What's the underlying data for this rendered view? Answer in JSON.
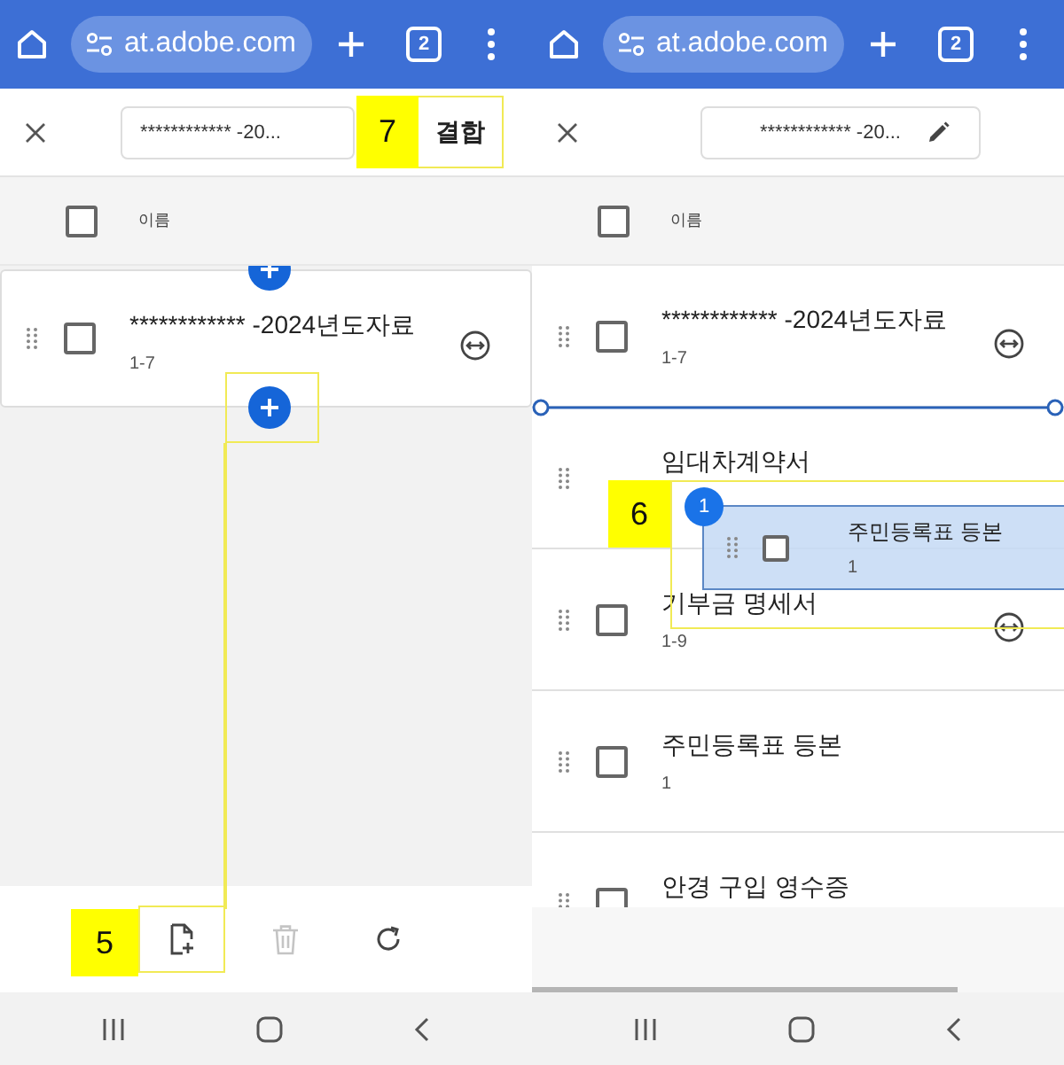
{
  "panels": [
    {
      "browser": {
        "url": "at.adobe.com",
        "tab_count": "2"
      },
      "toolbar": {
        "filename": "************ -20...",
        "trailing": {
          "kind": "button",
          "label": "결합"
        }
      },
      "header": {
        "label": "이름",
        "checked": false
      },
      "insert_buttons": true,
      "rows": [
        {
          "kind": "card",
          "title": "************ -2024년도자료",
          "pages": "1-7",
          "checked": false,
          "expandable": true,
          "drop_indicator": false
        }
      ],
      "bottom_toolbar": [
        {
          "kind": "add-file",
          "disabled": false
        },
        {
          "kind": "delete",
          "disabled": true
        },
        {
          "kind": "refresh",
          "disabled": false
        }
      ],
      "callouts": [
        {
          "kind": "toolbar",
          "label": "7"
        },
        {
          "kind": "bottom",
          "label": "5"
        }
      ]
    },
    {
      "browser": {
        "url": "at.adobe.com",
        "tab_count": "2"
      },
      "toolbar": {
        "filename": "************ -20...",
        "trailing": {
          "kind": "pencil"
        }
      },
      "header": {
        "label": "이름",
        "checked": false
      },
      "rows": [
        {
          "kind": "row",
          "title": "************ -2024년도자료",
          "pages": "1-7",
          "checked": false,
          "expandable": true,
          "drop_indicator": true
        },
        {
          "kind": "row",
          "title": "임대차계약서",
          "expandable": false,
          "drop_indicator": false
        },
        {
          "kind": "row",
          "title": "기부금 명세서",
          "pages": "1-9",
          "checked": false,
          "expandable": true,
          "drop_indicator": false
        },
        {
          "kind": "row",
          "title": "주민등록표 등본",
          "pages": "1",
          "checked": false,
          "expandable": false,
          "drop_indicator": false
        },
        {
          "kind": "row",
          "title": "안경 구입 영수증",
          "checked": false,
          "expandable": false,
          "drop_indicator": false
        }
      ],
      "drag_card": {
        "title": "주민등록표 등본",
        "pages": "1",
        "count": "1",
        "checked": false
      },
      "callouts": [
        {
          "kind": "drag",
          "label": "6"
        }
      ]
    }
  ]
}
